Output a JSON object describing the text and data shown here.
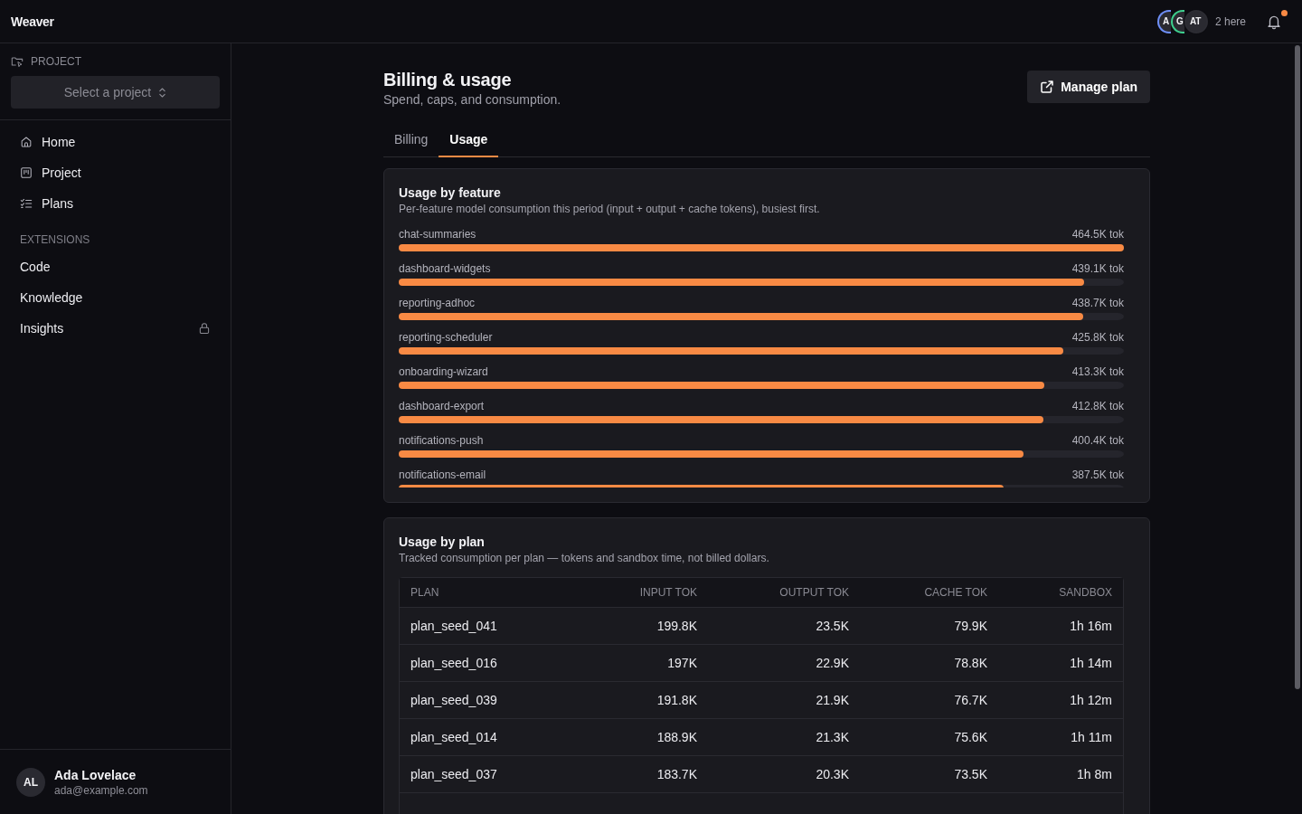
{
  "topbar": {
    "app_name": "Weaver",
    "presence": {
      "avatars": [
        {
          "initials": "A",
          "color": "#6e8ff7"
        },
        {
          "initials": "G",
          "color": "#3ecf8e"
        },
        {
          "initials": "AT",
          "color": "#2c2c33"
        }
      ],
      "label": "2 here"
    },
    "notifications": {
      "unread": true
    }
  },
  "sidebar": {
    "project": {
      "label": "PROJECT",
      "placeholder": "Select a project"
    },
    "nav": [
      {
        "label": "Home",
        "selected": false
      },
      {
        "label": "Project",
        "selected": false
      },
      {
        "label": "Plans",
        "selected": false
      }
    ],
    "extensions": {
      "label": "EXTENSIONS",
      "items": [
        {
          "label": "Code",
          "selected": false,
          "locked": false
        },
        {
          "label": "Knowledge",
          "selected": false,
          "locked": false
        },
        {
          "label": "Insights",
          "selected": false,
          "locked": true
        }
      ]
    },
    "user": {
      "initials": "AL",
      "name": "Ada Lovelace",
      "email": "ada@example.com"
    }
  },
  "page": {
    "title": "Billing & usage",
    "subtitle": "Spend, caps, and consumption.",
    "action": "Manage plan",
    "tabs": [
      {
        "label": "Billing",
        "selected": false
      },
      {
        "label": "Usage",
        "selected": true
      }
    ],
    "feature_usage": {
      "title": "Usage by feature",
      "description": "Per-feature model consumption this period (input + output + cache tokens), busiest first.",
      "rows": [
        {
          "name": "chat-summaries",
          "reading": "464.5K tok",
          "level": 1.0
        },
        {
          "name": "dashboard-widgets",
          "reading": "439.1K tok",
          "level": 0.945
        },
        {
          "name": "reporting-adhoc",
          "reading": "438.7K tok",
          "level": 0.944
        },
        {
          "name": "reporting-scheduler",
          "reading": "425.8K tok",
          "level": 0.917
        },
        {
          "name": "onboarding-wizard",
          "reading": "413.3K tok",
          "level": 0.89
        },
        {
          "name": "dashboard-export",
          "reading": "412.8K tok",
          "level": 0.889
        },
        {
          "name": "notifications-push",
          "reading": "400.4K tok",
          "level": 0.862
        },
        {
          "name": "notifications-email",
          "reading": "387.5K tok",
          "level": 0.834
        }
      ]
    },
    "plan_usage": {
      "title": "Usage by plan",
      "description": "Tracked consumption per plan — tokens and sandbox time, not billed dollars.",
      "table": {
        "columns": [
          "PLAN",
          "INPUT TOK",
          "OUTPUT TOK",
          "CACHE TOK",
          "SANDBOX"
        ],
        "rows": [
          [
            "plan_seed_041",
            "199.8K",
            "23.5K",
            "79.9K",
            "1h 16m"
          ],
          [
            "plan_seed_016",
            "197K",
            "22.9K",
            "78.8K",
            "1h 14m"
          ],
          [
            "plan_seed_039",
            "191.8K",
            "21.9K",
            "76.7K",
            "1h 12m"
          ],
          [
            "plan_seed_014",
            "188.9K",
            "21.3K",
            "75.6K",
            "1h 11m"
          ],
          [
            "plan_seed_037",
            "183.7K",
            "20.3K",
            "73.5K",
            "1h 8m"
          ]
        ]
      }
    }
  }
}
